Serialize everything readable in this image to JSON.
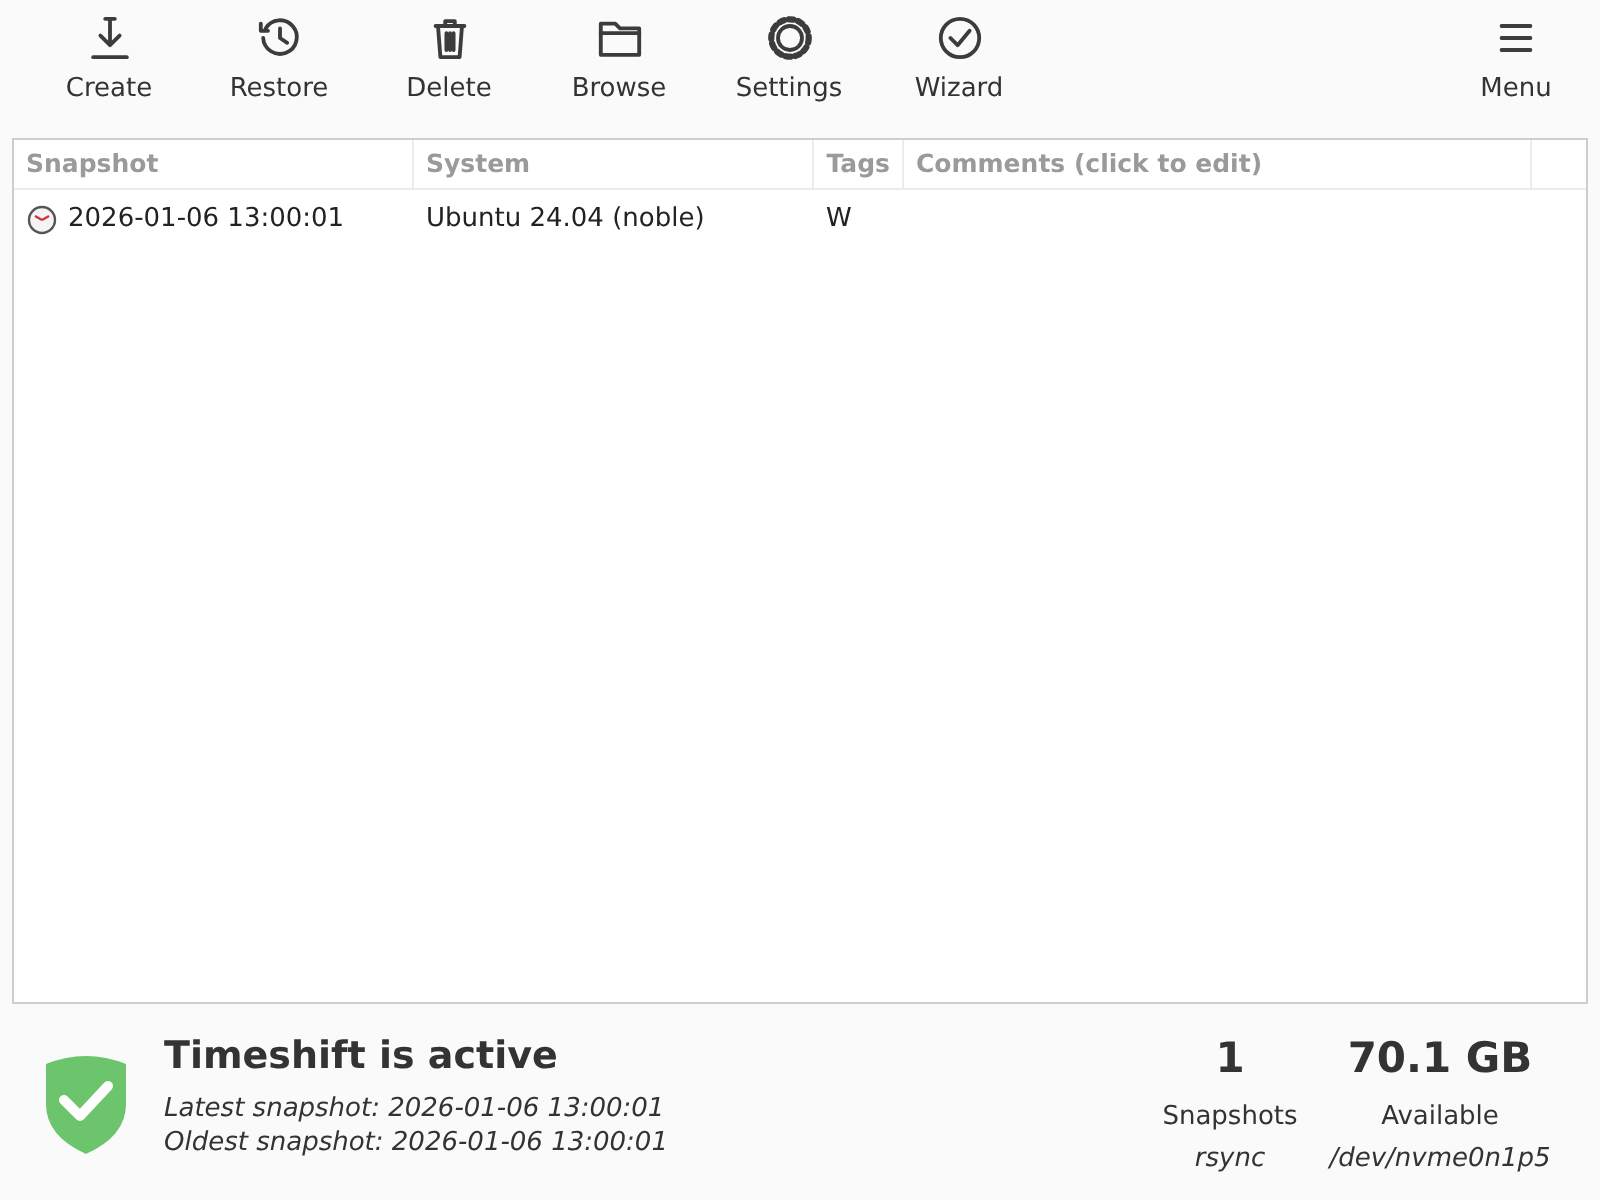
{
  "toolbar": {
    "buttons": [
      {
        "label": "Create"
      },
      {
        "label": "Restore"
      },
      {
        "label": "Delete"
      },
      {
        "label": "Browse"
      },
      {
        "label": "Settings"
      },
      {
        "label": "Wizard"
      }
    ],
    "menu": {
      "label": "Menu"
    }
  },
  "table": {
    "columns": [
      "Snapshot",
      "System",
      "Tags",
      "Comments (click to edit)"
    ],
    "rows": [
      {
        "snapshot": "2026-01-06 13:00:01",
        "system": "Ubuntu 24.04 (noble)",
        "tags": "W",
        "comments": ""
      }
    ]
  },
  "status": {
    "title": "Timeshift is active",
    "latest": "Latest snapshot: 2026-01-06 13:00:01",
    "oldest": "Oldest snapshot: 2026-01-06 13:00:01",
    "stats": [
      {
        "value": "1",
        "label": "Snapshots",
        "detail": "rsync"
      },
      {
        "value": "70.1 GB",
        "label": "Available",
        "detail": "/dev/nvme0n1p5"
      }
    ]
  }
}
